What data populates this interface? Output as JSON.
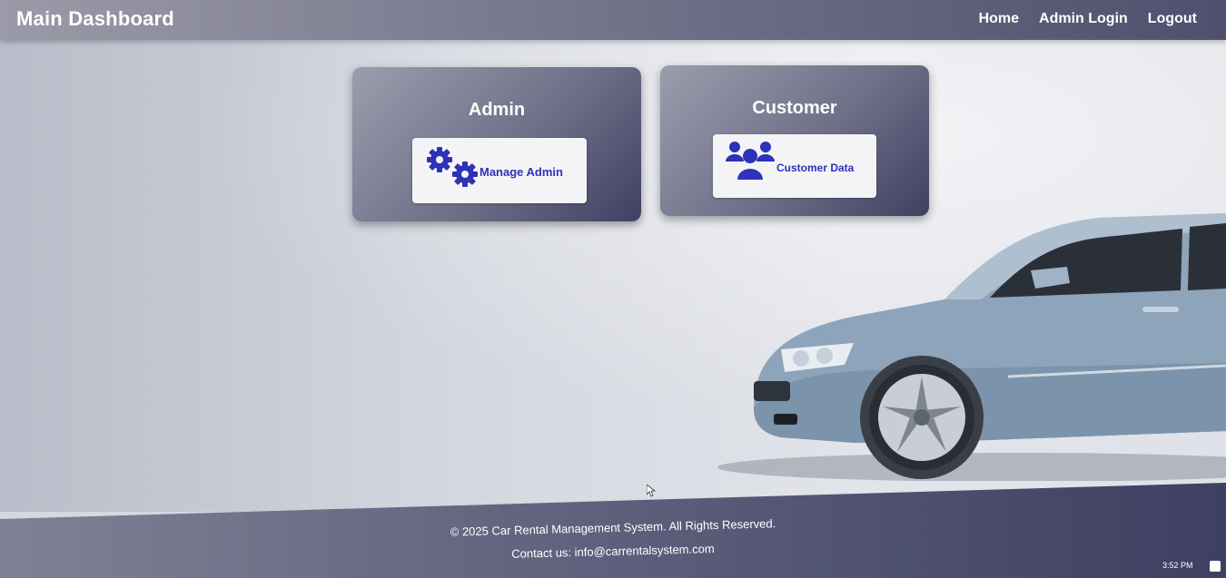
{
  "header": {
    "title": "Main Dashboard",
    "nav": [
      "Home",
      "Admin Login",
      "Logout"
    ]
  },
  "cards": {
    "admin": {
      "title": "Admin",
      "button_label": "Manage Admin",
      "icon": "gears-icon"
    },
    "customer": {
      "title": "Customer",
      "button_label": "Customer Data",
      "icon": "users-icon"
    }
  },
  "footer": {
    "copyright": "© 2025 Car Rental Management System. All Rights Reserved.",
    "contact": "Contact us: info@carrentalsystem.com"
  },
  "taskbar": {
    "time": "3:52 PM"
  },
  "colors": {
    "accent": "#2e32b8",
    "header_dark": "#4f506e",
    "car_body": "#8ea4bb"
  }
}
